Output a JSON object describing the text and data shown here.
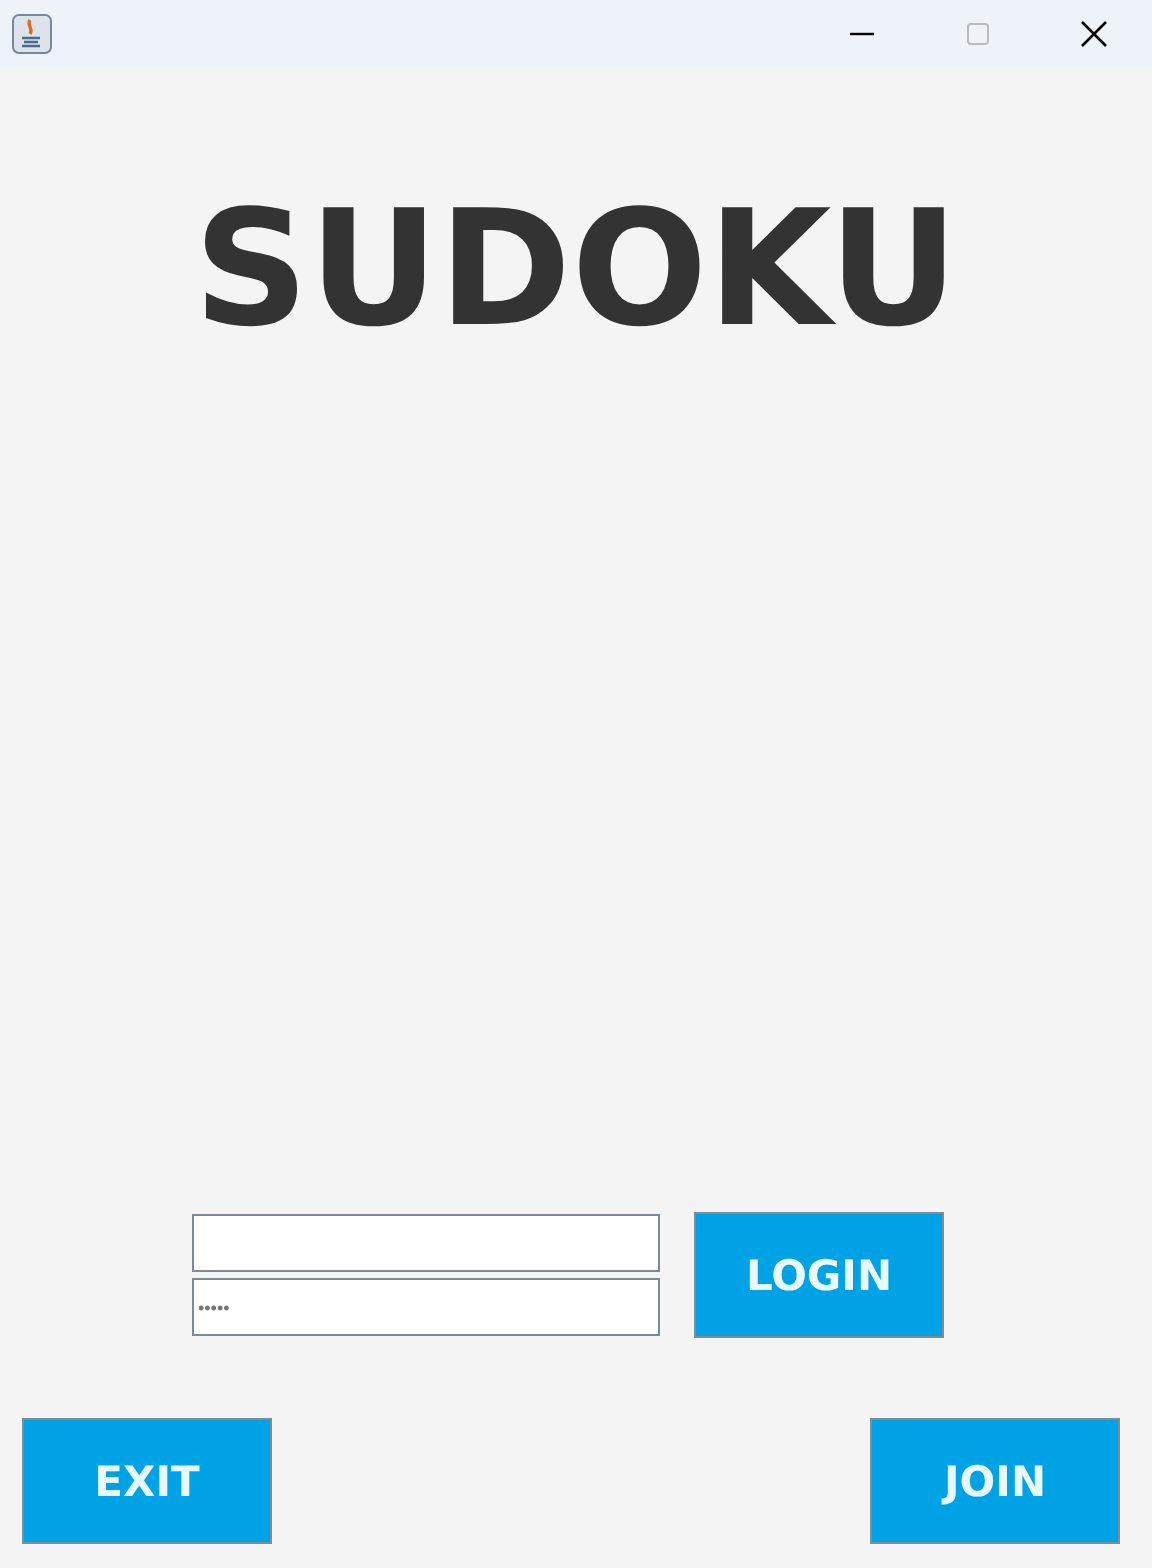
{
  "title": "SUDOKU",
  "login": {
    "password_field": {
      "value": "•••••"
    },
    "login_button": "LOGIN"
  },
  "exit_button": "EXIT",
  "join_button": "JOIN"
}
